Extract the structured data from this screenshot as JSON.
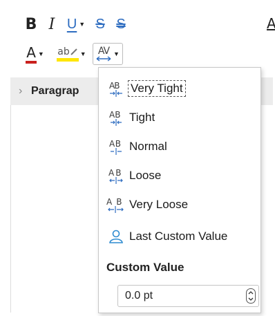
{
  "toolbar": {
    "bold_label": "B",
    "italic_label": "I",
    "underline_label": "U",
    "strike_label": "S",
    "double_strike_label": "S",
    "truncated_label": "A",
    "font_color_label": "A",
    "highlight_label": "ab",
    "spacing_label": "AV"
  },
  "sidebar": {
    "paragraph_label": "Paragrap"
  },
  "menu": {
    "items": [
      {
        "label": "Very Tight",
        "icon": "very-tight-spacing-icon"
      },
      {
        "label": "Tight",
        "icon": "tight-spacing-icon"
      },
      {
        "label": "Normal",
        "icon": "normal-spacing-icon"
      },
      {
        "label": "Loose",
        "icon": "loose-spacing-icon"
      },
      {
        "label": "Very Loose",
        "icon": "very-loose-spacing-icon"
      },
      {
        "label": "Last Custom Value",
        "icon": "user-icon"
      }
    ],
    "selected_index": 0,
    "custom_heading": "Custom Value",
    "custom_value": "0.0 pt"
  },
  "colors": {
    "accent_blue": "#2d6cc0",
    "font_color_red": "#c9211e",
    "highlight_yellow": "#ffe600"
  }
}
